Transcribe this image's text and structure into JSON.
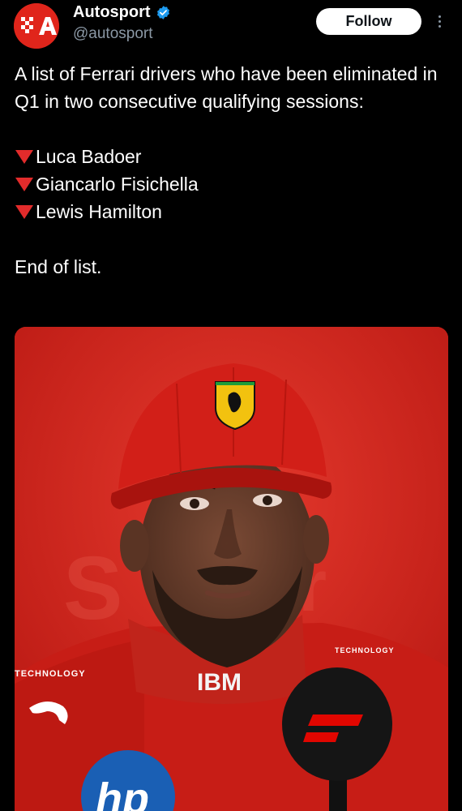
{
  "account": {
    "name": "Autosport",
    "handle": "@autosport",
    "avatar_icon": "autosport-logo",
    "verified_icon": "verified-badge-icon",
    "brand_color": "#e0251b"
  },
  "actions": {
    "follow_label": "Follow",
    "more_icon": "more-options-icon"
  },
  "tweet": {
    "intro": "A list of Ferrari drivers who have been eliminated in Q1 in two consecutive qualifying sessions:",
    "drivers": [
      "Luca Badoer",
      "Giancarlo Fisichella",
      "Lewis Hamilton"
    ],
    "bullet_icon": "red-triangle-down-icon",
    "outro": "End of list."
  },
  "media": {
    "photo_icon": "driver-photo",
    "sponsors": {
      "left": "TECHNOLOGY",
      "right": "TECHNOLOGY",
      "chest": "IBM"
    }
  },
  "colors": {
    "background": "#000000",
    "text": "#ffffff",
    "muted": "#8b98a5",
    "verified": "#1d9bf0",
    "ferrari_red": "#d4211a"
  }
}
